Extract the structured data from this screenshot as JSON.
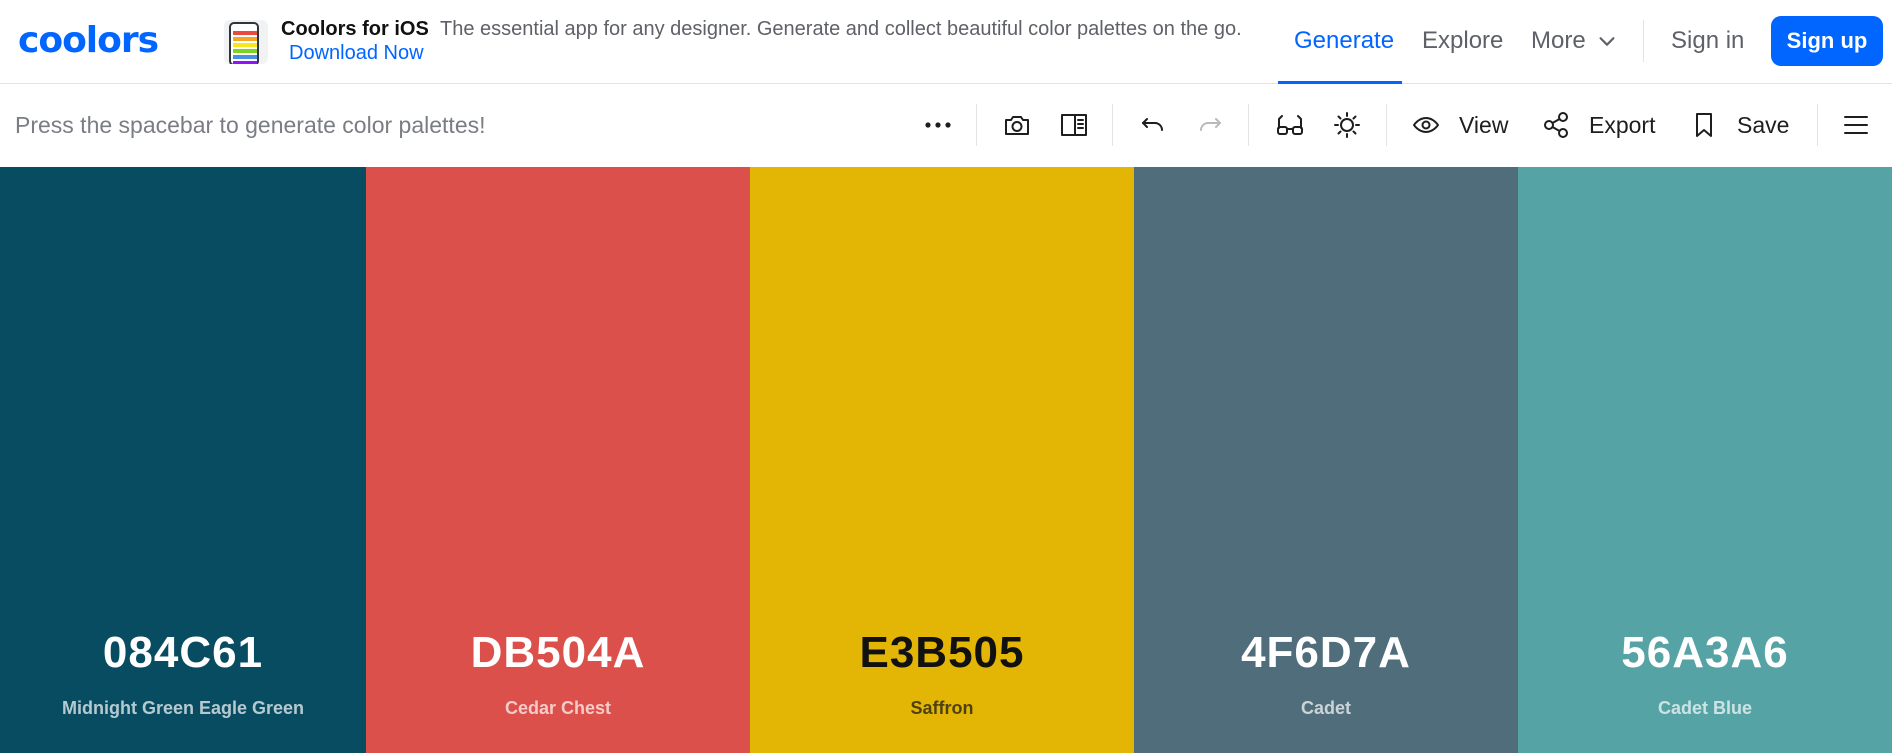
{
  "header": {
    "logo_text": "coolors",
    "promo": {
      "title": "Coolors for iOS",
      "text": "The essential app for any designer. Generate and collect beautiful color palettes on the go.",
      "link": "Download Now"
    },
    "nav": {
      "generate": "Generate",
      "explore": "Explore",
      "more": "More",
      "sign_in": "Sign in",
      "sign_up": "Sign up"
    },
    "accent_color": "#0066ff"
  },
  "toolbar": {
    "hint": "Press the spacebar to generate color palettes!",
    "view_label": "View",
    "export_label": "Export",
    "save_label": "Save"
  },
  "palette": [
    {
      "hex": "084C61",
      "name": "Midnight Green Eagle Green",
      "color": "#084C61",
      "text_color": "#ffffff"
    },
    {
      "hex": "DB504A",
      "name": "Cedar Chest",
      "color": "#DB504A",
      "text_color": "#ffffff"
    },
    {
      "hex": "E3B505",
      "name": "Saffron",
      "color": "#E3B505",
      "text_color": "#111111"
    },
    {
      "hex": "4F6D7A",
      "name": "Cadet",
      "color": "#4F6D7A",
      "text_color": "#ffffff"
    },
    {
      "hex": "56A3A6",
      "name": "Cadet Blue",
      "color": "#56A3A6",
      "text_color": "#ffffff"
    }
  ]
}
